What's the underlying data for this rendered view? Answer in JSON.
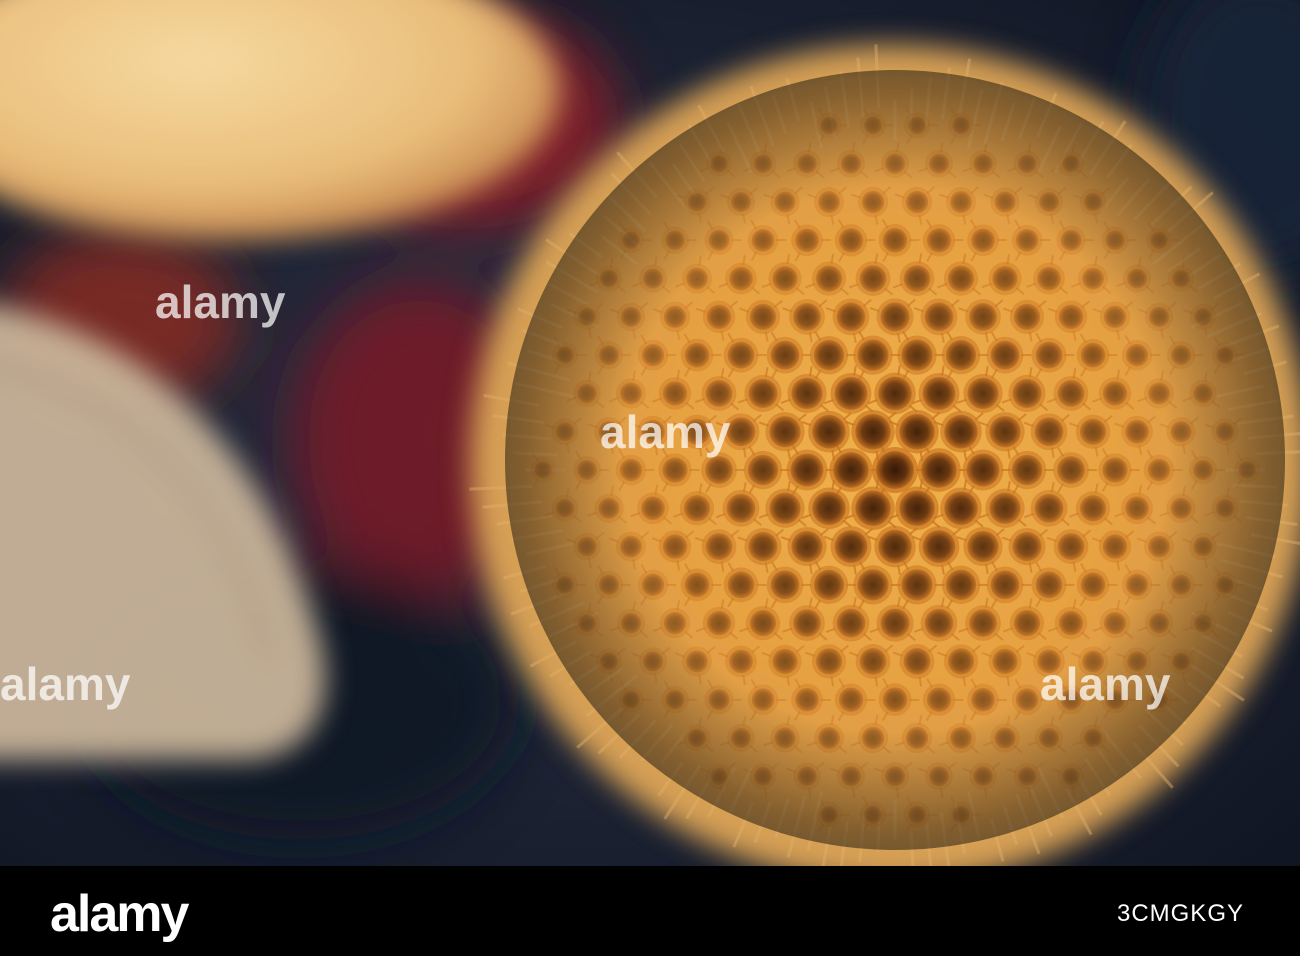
{
  "photo": {
    "subject": "macro-fungus-fruiting-body",
    "colors": {
      "fungus": "#e9a947",
      "fungus_rim": "#c9731f",
      "pore_dark": "#3a1a06",
      "background": "#1b2538",
      "berry": "#8a1f28",
      "leaf": "#c9b49a"
    }
  },
  "watermark": {
    "text": "alamy"
  },
  "footer": {
    "logo": "alamy",
    "image_code": "3CMGKGY"
  }
}
